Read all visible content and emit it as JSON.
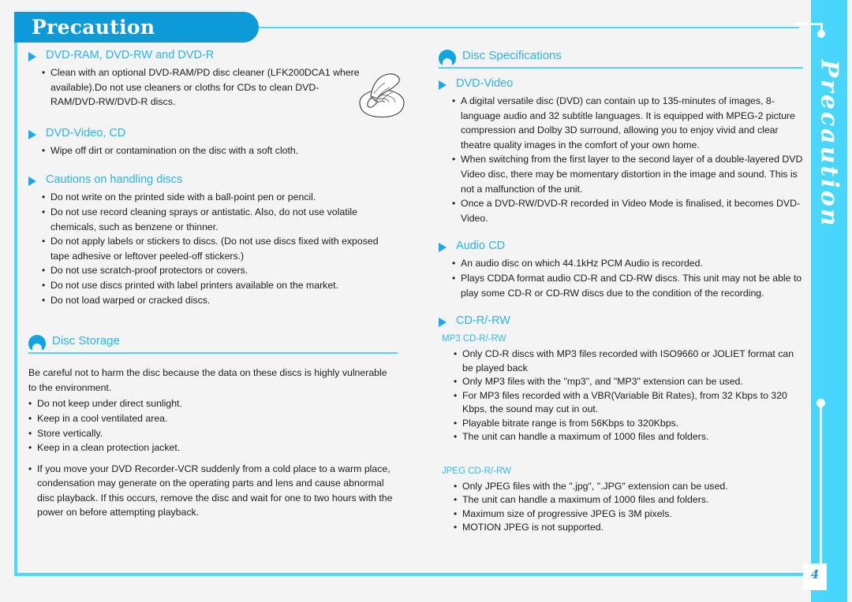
{
  "page": {
    "title": "Precaution",
    "side_tab_title": "Precaution",
    "page_number": "4",
    "accent_header": "#0d9ad8",
    "accent_cyan": "#4cd7fb",
    "accent_link": "#29b4ef"
  },
  "left_column": {
    "groups": [
      {
        "heading": "DVD-RAM, DVD-RW and DVD-R",
        "bullets": [
          "Clean with an optional DVD-RAM/PD disc cleaner (LFK200DCA1 where available).Do not use cleaners or cloths for CDs to clean DVD-RAM/DVD-RW/DVD-R discs."
        ]
      },
      {
        "heading": "DVD-Video, CD",
        "bullets": [
          "Wipe off dirt or contamination on the disc with a soft cloth."
        ]
      },
      {
        "heading": "Cautions on handling discs",
        "bullets": [
          "Do not write on the printed side with a ball-point pen or pencil.",
          "Do not use record cleaning sprays or antistatic. Also, do not use volatile chemicals, such as benzene or thinner.",
          "Do not apply labels or stickers to discs. (Do not use discs fixed with exposed tape adhesive or leftover peeled-off stickers.)",
          "Do not use scratch-proof protectors or covers.",
          "Do not use discs printed with label printers available on the market.",
          "Do not load warped or cracked discs."
        ]
      }
    ],
    "disc_storage": {
      "heading": "Disc Storage",
      "intro": "Be careful not to harm the disc because the data on these discs is highly vulnerable to the environment.",
      "bullets": [
        "Do not keep under direct sunlight.",
        "Keep in a cool ventilated area.",
        "Store vertically.",
        "Keep in a clean protection jacket.",
        "If you move your DVD Recorder-VCR suddenly from a cold place to a warm place, condensation may generate on the operating parts and lens and cause abnormal disc playback. If this occurs, remove the disc and wait for one to two hours with the power on before attempting playback."
      ]
    }
  },
  "right_column": {
    "disc_specifications": {
      "heading": "Disc Specifications",
      "groups": [
        {
          "heading": "DVD-Video",
          "bullets": [
            "A digital versatile disc (DVD) can contain up to 135-minutes of images, 8-language audio and 32 subtitle languages. It is equipped with MPEG-2 picture compression and Dolby 3D surround, allowing you to enjoy vivid and clear theatre quality images in the comfort of your own home.",
            "When switching from the first layer to the second layer of a double-layered DVD Video disc, there may be momentary distortion in the image and sound. This is not a malfunction of the unit.",
            "Once a DVD-RW/DVD-R recorded in Video Mode is finalised, it becomes DVD-Video."
          ]
        },
        {
          "heading": "Audio CD",
          "bullets": [
            "An audio disc on which 44.1kHz PCM Audio is recorded.",
            "Plays CDDA format audio CD-R and CD-RW discs. This unit may not be able to play some CD-R or CD-RW discs due to the condition of the recording."
          ]
        },
        {
          "heading": "CD-R/-RW",
          "subsections": [
            {
              "heading": "MP3 CD-R/-RW",
              "bullets": [
                "Only CD-R discs with MP3 files recorded with ISO9660 or JOLIET format can be played back",
                "Only MP3 files with the \"mp3\", and \"MP3\" extension can be used.",
                "For MP3 files recorded with a VBR(Variable Bit Rates), from 32 Kbps to 320 Kbps, the sound may cut in out.",
                "Playable bitrate range is from 56Kbps to 320Kbps.",
                "The unit can handle a maximum of 1000 files and folders."
              ]
            },
            {
              "heading": "JPEG CD-R/-RW",
              "bullets": [
                "Only JPEG files with the \".jpg\", \".JPG\" extension can be used.",
                "The unit can handle a maximum of 1000 files and folders.",
                "Maximum size of progressive JPEG is 3M pixels.",
                "MOTION JPEG is not supported."
              ]
            }
          ]
        }
      ]
    }
  }
}
